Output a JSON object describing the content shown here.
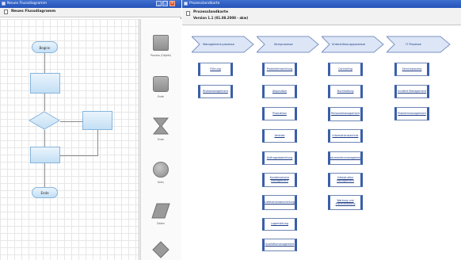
{
  "left_window": {
    "title": "Neues Flussdiagramm",
    "subtitle": "Neues Flussdiagramm",
    "flowchart": {
      "begin_label": "Beginn",
      "end_label": "Ende"
    },
    "stencil": {
      "items": [
        {
          "label": "Prozess (Objekt)",
          "icon": "process-square-icon"
        },
        {
          "label": "Ende",
          "icon": "terminator-square-icon"
        },
        {
          "label": "Ende",
          "icon": "hourglass-icon"
        },
        {
          "label": "Kreis",
          "icon": "circle-icon"
        },
        {
          "label": "Daten",
          "icon": "parallelogram-icon"
        },
        {
          "label": "",
          "icon": "diamond-icon"
        }
      ]
    }
  },
  "right_window": {
    "title": "Prozesslandkarte",
    "subtitle": "Prozesslandkarte",
    "version": "Version 1.1 (01.08.2008 - akw)",
    "columns": [
      {
        "header": "Management-prozesse",
        "items": [
          "Führung",
          "Risikomanagement"
        ]
      },
      {
        "header": "Kernprozesse",
        "items": [
          "Produktentwicklung",
          "Akquisition",
          "Produktion",
          "Vertrieb",
          "Auftragsabwicklung",
          "Kundenservice Management",
          "Lieferantenbeurteilung",
          "Lagerhaltung",
          "Qualitätsmanagement"
        ]
      },
      {
        "header": "Unterstützungsprozesse",
        "items": [
          "Controlling",
          "Buchhaltung",
          "Personalmanagement",
          "Informationstechnik",
          "Dokumentenmanagement",
          "Infrastruktur Management",
          "Wartung und Instandhaltung"
        ]
      },
      {
        "header": "IT Prozesse",
        "items": [
          "Serviceprozess",
          "Incident Management",
          "Problemmanagement"
        ]
      }
    ]
  },
  "colors": {
    "titlebar": "#2553b8",
    "chevron": "#dce6f7",
    "box_border": "#3a5fa8",
    "flow_shape": "#c3dff5"
  }
}
